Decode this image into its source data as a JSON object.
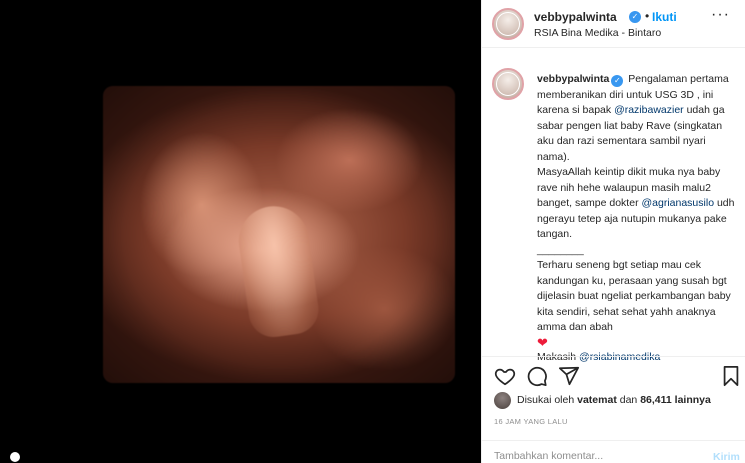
{
  "header": {
    "username": "vebbypalwinta",
    "separator": "•",
    "follow_label": "Ikuti",
    "location": "RSIA Bina Medika - Bintaro",
    "more_icon": "more-horizontal-icon"
  },
  "caption": {
    "username": "vebbypalwinta",
    "text_1": "Pengalaman pertama memberanikan diri untuk USG 3D , ini karena si bapak",
    "mention_1": "@razibawazier",
    "text_2": "udah ga sabar pengen liat baby Rave (singkatan aku dan razi sementara sambil nyari nama).",
    "text_3": "MasyaAllah keintip dikit muka nya baby rave nih hehe walaupun masih malu2 banget, sampe dokter",
    "mention_2": "@agrianasusilo",
    "text_4": "udh ngerayu tetep aja nutupin mukanya pake tangan.",
    "divider": "________",
    "text_5": "Terharu seneng bgt setiap mau cek kandungan ku, perasaan yang susah bgt dijelasin buat ngeliat perkambangan baby kita sendiri, sehat sehat yahh anaknya amma dan abah",
    "heart": "❤",
    "text_6": "Makasih",
    "mention_3": "@rsiabinamedika"
  },
  "actions": {
    "like_icon": "heart-outline-icon",
    "comment_icon": "comment-icon",
    "share_icon": "share-icon",
    "save_icon": "bookmark-icon"
  },
  "likes": {
    "prefix": "Disukai oleh",
    "user": "vatemat",
    "middle": "dan",
    "count": "86,411 lainnya"
  },
  "time_ago": "16 JAM YANG LALU",
  "comment": {
    "placeholder": "Tambahkan komentar...",
    "post_label": "Kirim"
  },
  "colors": {
    "accent": "#0095f6",
    "verified": "#3897f0",
    "mention": "#00376b",
    "heart": "#ed1c3a"
  }
}
